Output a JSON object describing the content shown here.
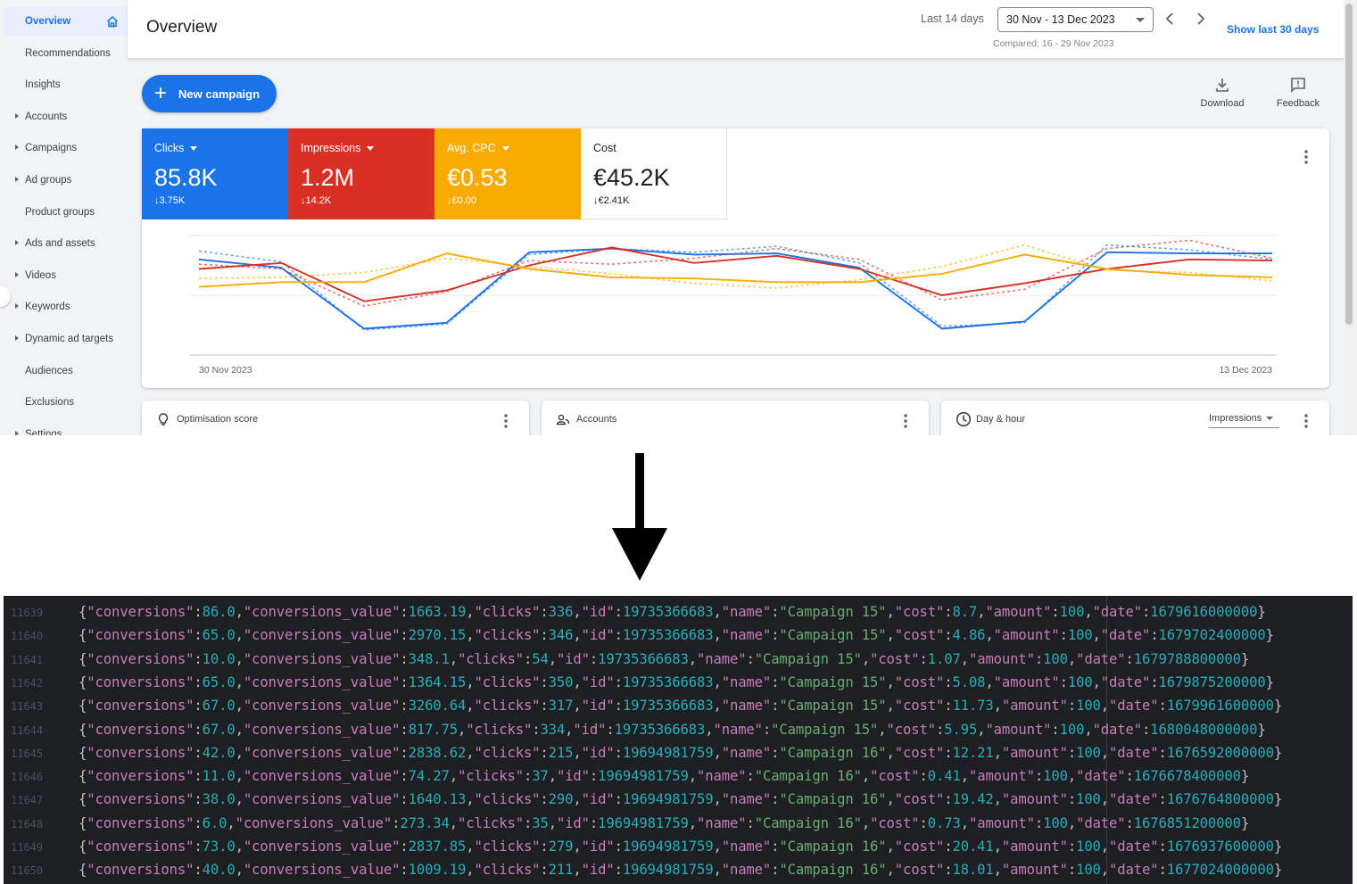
{
  "sidebar": {
    "items": [
      {
        "label": "Overview",
        "active": true,
        "caret": false
      },
      {
        "label": "Recommendations",
        "caret": false
      },
      {
        "label": "Insights",
        "caret": false
      },
      {
        "label": "Accounts",
        "caret": true
      },
      {
        "label": "Campaigns",
        "caret": true
      },
      {
        "label": "Ad groups",
        "caret": true
      },
      {
        "label": "Product groups",
        "caret": false
      },
      {
        "label": "Ads and assets",
        "caret": true
      },
      {
        "label": "Videos",
        "caret": true
      },
      {
        "label": "Keywords",
        "caret": true
      },
      {
        "label": "Dynamic ad targets",
        "caret": true
      },
      {
        "label": "Audiences",
        "caret": false
      },
      {
        "label": "Exclusions",
        "caret": false
      },
      {
        "label": "Settings",
        "caret": true
      }
    ]
  },
  "header": {
    "title": "Overview",
    "date_range_label": "Last 14 days",
    "date_range_value": "30 Nov - 13 Dec 2023",
    "compared_text": "Compared: 16 - 29 Nov 2023",
    "show_more_link": "Show last 30 days"
  },
  "actions": {
    "new_campaign": "New campaign",
    "download": "Download",
    "feedback": "Feedback"
  },
  "metrics": [
    {
      "label": "Clicks",
      "value": "85.8K",
      "delta": "3.75K",
      "color": "#1a73e8",
      "dropdown": true
    },
    {
      "label": "Impressions",
      "value": "1.2M",
      "delta": "14.2K",
      "color": "#d93025",
      "dropdown": true
    },
    {
      "label": "Avg. CPC",
      "value": "€0.53",
      "delta": "€0.00",
      "color": "#f9ab00",
      "dropdown": true
    },
    {
      "label": "Cost",
      "value": "€45.2K",
      "delta": "€2.41K",
      "color": "#ffffff",
      "dropdown": false
    }
  ],
  "chart_data": {
    "type": "line",
    "x_start_label": "30 Nov 2023",
    "x_end_label": "13 Dec 2023",
    "grid": true,
    "series": [
      {
        "name": "Clicks",
        "color": "#1a73e8",
        "style": "solid",
        "values": [
          0.8,
          0.73,
          0.22,
          0.27,
          0.86,
          0.89,
          0.84,
          0.85,
          0.73,
          0.22,
          0.28,
          0.86,
          0.85,
          0.85
        ]
      },
      {
        "name": "Clicks",
        "color": "#1a73e8",
        "style": "dashed",
        "values": [
          0.87,
          0.78,
          0.21,
          0.26,
          0.84,
          0.89,
          0.86,
          0.91,
          0.77,
          0.24,
          0.27,
          0.92,
          0.88,
          0.8
        ]
      },
      {
        "name": "Impressions",
        "color": "#d93025",
        "style": "solid",
        "values": [
          0.72,
          0.77,
          0.45,
          0.54,
          0.75,
          0.9,
          0.77,
          0.83,
          0.72,
          0.5,
          0.6,
          0.72,
          0.8,
          0.79
        ]
      },
      {
        "name": "Impressions",
        "color": "#d93025",
        "style": "dashed",
        "values": [
          0.76,
          0.72,
          0.41,
          0.53,
          0.79,
          0.76,
          0.81,
          0.89,
          0.8,
          0.46,
          0.55,
          0.89,
          0.96,
          0.81
        ]
      },
      {
        "name": "Avg. CPC",
        "color": "#f9ab00",
        "style": "solid",
        "values": [
          0.57,
          0.61,
          0.61,
          0.85,
          0.72,
          0.65,
          0.64,
          0.61,
          0.61,
          0.68,
          0.84,
          0.72,
          0.67,
          0.65
        ]
      },
      {
        "name": "Avg. CPC",
        "color": "#f9ab00",
        "style": "dashed",
        "values": [
          0.64,
          0.65,
          0.69,
          0.81,
          0.74,
          0.68,
          0.6,
          0.56,
          0.63,
          0.74,
          0.92,
          0.71,
          0.69,
          0.62
        ]
      }
    ]
  },
  "cards": {
    "optimisation": "Optimisation score",
    "accounts": "Accounts",
    "day_hour": "Day & hour",
    "day_hour_metric": "Impressions"
  },
  "code": {
    "lines": [
      {
        "num": "11639",
        "conversions": "86.0",
        "value": "1663.19",
        "clicks": "336",
        "id": "19735366683",
        "name": "Campaign 15",
        "cost": "8.7",
        "amount": "100",
        "date": "1679616000000"
      },
      {
        "num": "11640",
        "conversions": "65.0",
        "value": "2970.15",
        "clicks": "346",
        "id": "19735366683",
        "name": "Campaign 15",
        "cost": "4.86",
        "amount": "100",
        "date": "1679702400000"
      },
      {
        "num": "11641",
        "conversions": "10.0",
        "value": "348.1",
        "clicks": "54",
        "id": "19735366683",
        "name": "Campaign 15",
        "cost": "1.07",
        "amount": "100",
        "date": "1679788800000"
      },
      {
        "num": "11642",
        "conversions": "65.0",
        "value": "1364.15",
        "clicks": "350",
        "id": "19735366683",
        "name": "Campaign 15",
        "cost": "5.08",
        "amount": "100",
        "date": "1679875200000"
      },
      {
        "num": "11643",
        "conversions": "67.0",
        "value": "3260.64",
        "clicks": "317",
        "id": "19735366683",
        "name": "Campaign 15",
        "cost": "11.73",
        "amount": "100",
        "date": "1679961600000"
      },
      {
        "num": "11644",
        "conversions": "67.0",
        "value": "817.75",
        "clicks": "334",
        "id": "19735366683",
        "name": "Campaign 15",
        "cost": "5.95",
        "amount": "100",
        "date": "1680048000000"
      },
      {
        "num": "11645",
        "conversions": "42.0",
        "value": "2838.62",
        "clicks": "215",
        "id": "19694981759",
        "name": "Campaign 16",
        "cost": "12.21",
        "amount": "100",
        "date": "1676592000000"
      },
      {
        "num": "11646",
        "conversions": "11.0",
        "value": "74.27",
        "clicks": "37",
        "id": "19694981759",
        "name": "Campaign 16",
        "cost": "0.41",
        "amount": "100",
        "date": "1676678400000"
      },
      {
        "num": "11647",
        "conversions": "38.0",
        "value": "1640.13",
        "clicks": "290",
        "id": "19694981759",
        "name": "Campaign 16",
        "cost": "19.42",
        "amount": "100",
        "date": "1676764800000"
      },
      {
        "num": "11648",
        "conversions": "6.0",
        "value": "273.34",
        "clicks": "35",
        "id": "19694981759",
        "name": "Campaign 16",
        "cost": "0.73",
        "amount": "100",
        "date": "1676851200000"
      },
      {
        "num": "11649",
        "conversions": "73.0",
        "value": "2837.85",
        "clicks": "279",
        "id": "19694981759",
        "name": "Campaign 16",
        "cost": "20.41",
        "amount": "100",
        "date": "1676937600000"
      },
      {
        "num": "11650",
        "conversions": "40.0",
        "value": "1009.19",
        "clicks": "211",
        "id": "19694981759",
        "name": "Campaign 16",
        "cost": "18.01",
        "amount": "100",
        "date": "1677024000000"
      }
    ]
  }
}
